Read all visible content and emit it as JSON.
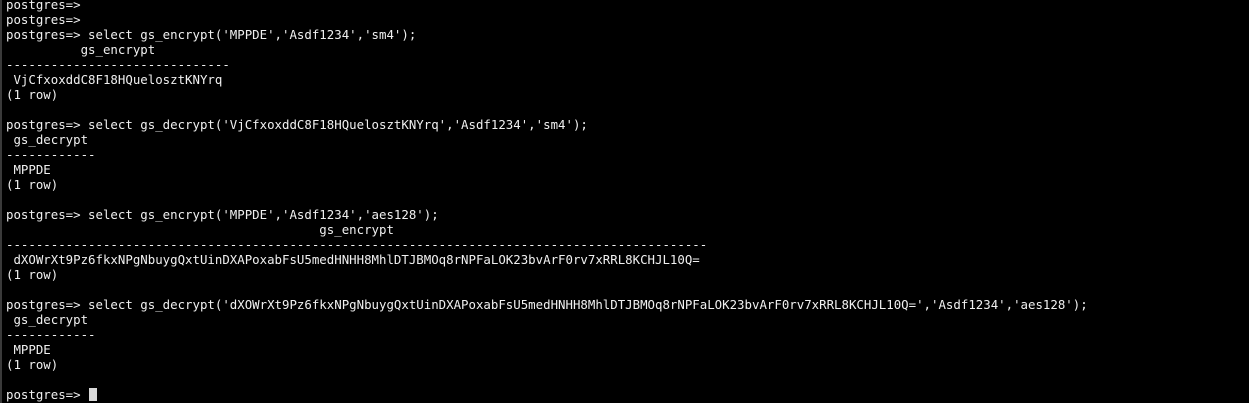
{
  "terminal": {
    "lines": [
      "postgres=>",
      "postgres=>",
      "postgres=> select gs_encrypt('MPPDE','Asdf1234','sm4');",
      "          gs_encrypt",
      "------------------------------",
      " VjCfxoxddC8F18HQuelosztKNYrq",
      "(1 row)",
      "",
      "postgres=> select gs_decrypt('VjCfxoxddC8F18HQuelosztKNYrq','Asdf1234','sm4');",
      " gs_decrypt",
      "------------",
      " MPPDE",
      "(1 row)",
      "",
      "postgres=> select gs_encrypt('MPPDE','Asdf1234','aes128');",
      "                                          gs_encrypt",
      "----------------------------------------------------------------------------------------------",
      " dXOWrXt9Pz6fkxNPgNbuygQxtUinDXAPoxabFsU5medHNHH8MhlDTJBMOq8rNPFaLOK23bvArF0rv7xRRL8KCHJL10Q=",
      "(1 row)",
      "",
      "postgres=> select gs_decrypt('dXOWrXt9Pz6fkxNPgNbuygQxtUinDXAPoxabFsU5medHNHH8MhlDTJBMOq8rNPFaLOK23bvArF0rv7xRRL8KCHJL10Q=','Asdf1234','aes128');",
      " gs_decrypt",
      "------------",
      " MPPDE",
      "(1 row)",
      ""
    ],
    "prompt": "postgres=> "
  }
}
